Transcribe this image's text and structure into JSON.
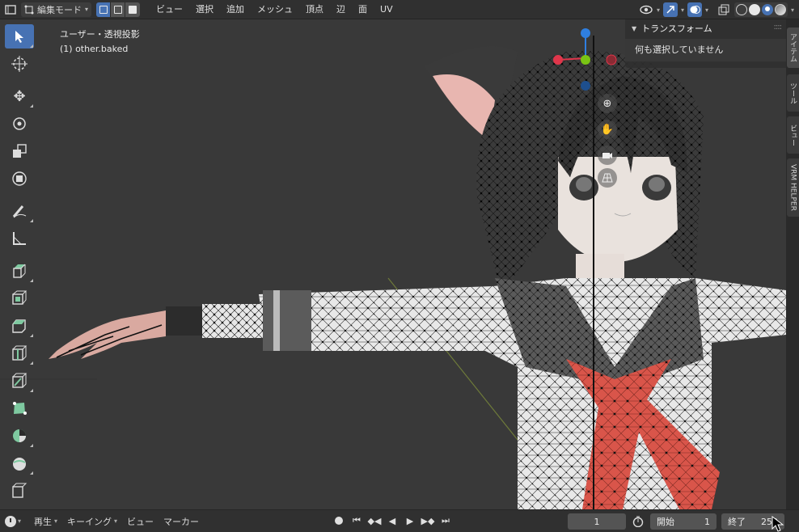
{
  "header": {
    "mode": "編集モード",
    "menus": [
      "ビュー",
      "選択",
      "追加",
      "メッシュ",
      "頂点",
      "辺",
      "面",
      "UV"
    ]
  },
  "viewport": {
    "view_name": "ユーザー・透視投影",
    "object_label": "(1) other.baked",
    "background_color": "#393939"
  },
  "toolbar": {
    "tools": [
      "select-box",
      "cursor",
      "move",
      "rotate",
      "scale",
      "transform",
      "annotate",
      "measure",
      "extrude-region",
      "inset-faces",
      "bevel",
      "loop-cut",
      "knife",
      "poly-build",
      "spin",
      "smooth",
      "edge-slide"
    ]
  },
  "npanel": {
    "section_title": "トランスフォーム",
    "message": "何も選択していません"
  },
  "side_tabs": [
    "アイテム",
    "ツール",
    "ビュー",
    "VRM HELPER"
  ],
  "timeline": {
    "playback": "再生",
    "keying": "キーイング",
    "view": "ビュー",
    "marker": "マーカー",
    "current_frame": "1",
    "start_label": "開始",
    "start_value": "1",
    "end_label": "終了",
    "end_value": "250"
  },
  "colors": {
    "accent": "#4772b3",
    "gizmo_x": "#e0364b",
    "gizmo_y": "#7ac414",
    "gizmo_z": "#2f7fe0",
    "tie": "#d9554a",
    "hair": "#2f2f2f"
  }
}
